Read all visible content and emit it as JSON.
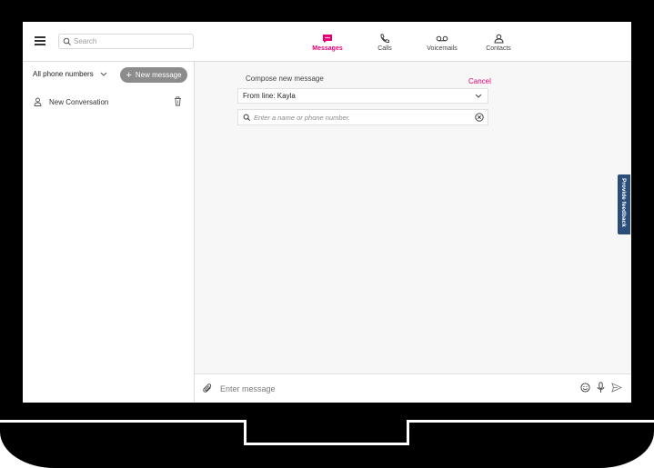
{
  "header": {
    "search_placeholder": "Search",
    "nav": [
      {
        "label": "Messages",
        "icon": "message-icon",
        "active": true
      },
      {
        "label": "Calls",
        "icon": "phone-icon",
        "active": false
      },
      {
        "label": "Voicemails",
        "icon": "voicemail-icon",
        "active": false
      },
      {
        "label": "Contacts",
        "icon": "contacts-icon",
        "active": false
      }
    ]
  },
  "sidebar": {
    "phone_filter": "All phone numbers",
    "new_message_label": "New message",
    "conversations": [
      {
        "label": "New Conversation"
      }
    ]
  },
  "compose": {
    "title": "Compose new message",
    "cancel_label": "Cancel",
    "from_line": "From line: Kayla",
    "recipient_placeholder": "Enter a name or phone number."
  },
  "feedback_label": "Provide feedback",
  "composer": {
    "placeholder": "Enter message"
  },
  "colors": {
    "accent": "#e20074",
    "feedback": "#2b4d7a",
    "new_message_button": "#8c8c8c"
  }
}
